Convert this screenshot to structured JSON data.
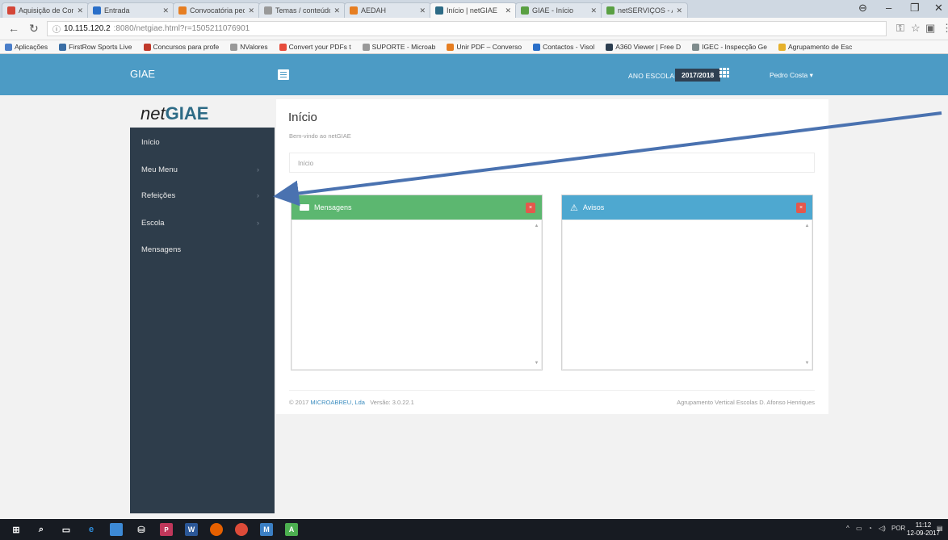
{
  "browser": {
    "tabs": [
      {
        "label": "Aquisição de Conv",
        "icon": "gmail-icon",
        "color": "#d44638"
      },
      {
        "label": "Entrada",
        "icon": "outlook-icon",
        "color": "#2a6fc9"
      },
      {
        "label": "Convocatória pedi",
        "icon": "doc-icon",
        "color": "#e67e22"
      },
      {
        "label": "Temas / conteúdos",
        "icon": "page-icon",
        "color": "#999999"
      },
      {
        "label": "AEDAH",
        "icon": "aedah-icon",
        "color": "#e67e22"
      },
      {
        "label": "Início | netGIAE",
        "icon": "giae-icon",
        "color": "#2d6b86"
      },
      {
        "label": "GIAE - Início",
        "icon": "giae-icon",
        "color": "#5aa043"
      },
      {
        "label": "netSERVIÇOS - Aju",
        "icon": "giae-icon",
        "color": "#5aa043"
      }
    ],
    "url_host": "10.115.120.2",
    "url_rest": ":8080/netgiae.html?r=1505211076901",
    "bookmarks": [
      {
        "label": "Aplicações",
        "icon": "apps-icon",
        "color": "#4a7ec9"
      },
      {
        "label": "FirstRow Sports Live",
        "icon": "sports-icon",
        "color": "#3a6ea5"
      },
      {
        "label": "Concursos para profe",
        "icon": "concursos-icon",
        "color": "#c0392b"
      },
      {
        "label": "NValores",
        "icon": "page-icon",
        "color": "#999999"
      },
      {
        "label": "Convert your PDFs t",
        "icon": "convert-icon",
        "color": "#e74c3c"
      },
      {
        "label": "SUPORTE - Microab",
        "icon": "page-icon",
        "color": "#999999"
      },
      {
        "label": "Unir PDF – Converso",
        "icon": "pdf-icon",
        "color": "#e67e22"
      },
      {
        "label": "Contactos - Visol",
        "icon": "visol-icon",
        "color": "#2a6fc9"
      },
      {
        "label": "A360 Viewer | Free D",
        "icon": "a360-icon",
        "color": "#2c3e50"
      },
      {
        "label": "IGEC - Inspecção Ge",
        "icon": "igec-icon",
        "color": "#7f8c8d"
      },
      {
        "label": "Agrupamento de Esc",
        "icon": "folder-icon",
        "color": "#e6b12b"
      }
    ]
  },
  "header": {
    "brand": "GIAE",
    "ano_label": "ANO ESCOLAR",
    "ano_value": "2017/2018",
    "user": "Pedro Costa ▾",
    "accent": "#4c9bc5"
  },
  "logo": {
    "prefix": "net",
    "name": "GIAE"
  },
  "sidebar": {
    "items": [
      {
        "label": "Início",
        "chevron": false
      },
      {
        "label": "Meu Menu",
        "chevron": true
      },
      {
        "label": "Refeições",
        "chevron": true
      },
      {
        "label": "Escola",
        "chevron": true
      },
      {
        "label": "Mensagens",
        "chevron": false
      }
    ]
  },
  "main": {
    "title": "Início",
    "subtitle": "Bem-vindo ao netGIAE",
    "breadcrumb": "Início",
    "panels": [
      {
        "title": "Mensagens",
        "icon": "message-icon",
        "color": "#5cb770",
        "close": "×"
      },
      {
        "title": "Avisos",
        "icon": "warning-icon",
        "color": "#4ea8d0",
        "close": "×"
      }
    ]
  },
  "footer": {
    "copyright": "© 2017",
    "company": "MICROABREU, Lda",
    "version": "Versão: 3.0.22.1",
    "school": "Agrupamento Vertical Escolas D. Afonso Henriques"
  },
  "taskbar": {
    "lang": "POR",
    "time": "11:12",
    "date": "12-09-2017"
  }
}
